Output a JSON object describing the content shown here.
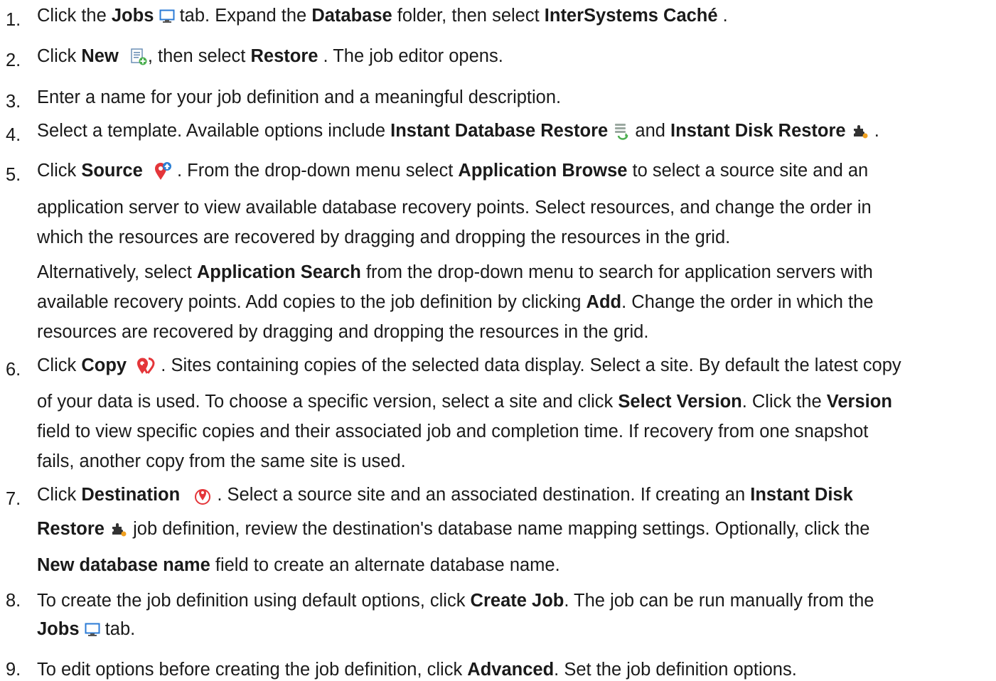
{
  "steps": [
    {
      "num": "1.",
      "t1": "Click the ",
      "b1": "Jobs",
      "t2": " tab. Expand the ",
      "b2": "Database",
      "t3": " folder, then select ",
      "b3": "InterSystems Caché",
      "t4": " ."
    },
    {
      "num": "2.",
      "t1": "Click ",
      "b1": "New",
      "t2": ", then select ",
      "b2": "Restore",
      "t3": " . The job editor opens."
    },
    {
      "num": "3.",
      "t1": "Enter a name for your job definition and a meaningful description."
    },
    {
      "num": "4.",
      "t1": "Select a template. Available options include ",
      "b1": "Instant Database Restore",
      "t2": " and ",
      "b2": "Instant Disk Restore",
      "t3": " ."
    },
    {
      "num": "5.",
      "l1": {
        "t1": "Click ",
        "b1": "Source",
        "t2": " . From the drop-down menu select ",
        "b2": "Application Browse",
        "t3": " to select a source site and an"
      },
      "l2": "application server to view available database recovery points. Select resources, and change the order in",
      "l3": "which the resources are recovered by dragging and dropping the resources in the grid.",
      "l4": {
        "t1": "Alternatively, select ",
        "b1": "Application Search",
        "t2": " from the drop-down menu to search for application servers with"
      },
      "l5": {
        "t1": "available recovery points. Add copies to the job definition by clicking ",
        "b1": "Add",
        "t2": ". Change the order in which the"
      },
      "l6": "resources are recovered by dragging and dropping the resources in the grid."
    },
    {
      "num": "6.",
      "l1": {
        "t1": "Click ",
        "b1": "Copy",
        "t2": " . Sites containing copies of the selected data display. Select a site. By default the latest copy"
      },
      "l2": {
        "t1": "of your data is used. To choose a specific version, select a site and click ",
        "b1": "Select Version",
        "t2": ". Click the ",
        "b2": "Version"
      },
      "l3": "field to view specific copies and their associated job and completion time. If recovery from one snapshot",
      "l4": "fails, another copy from the same site is used."
    },
    {
      "num": "7.",
      "l1": {
        "t1": "Click ",
        "b1": "Destination",
        "t2": " . Select a source site and an associated destination. If creating an ",
        "b2": "Instant Disk"
      },
      "l2": {
        "b1": "Restore",
        "t1": " job definition, review the destination's database name mapping settings. Optionally, click the"
      },
      "l3": {
        "b1": "New database name",
        "t1": " field to create an alternate database name."
      }
    },
    {
      "num": "8.",
      "l1": {
        "t1": "To create the job definition using default options, click ",
        "b1": "Create Job",
        "t2": ". The job can be run manually from the"
      },
      "l2": {
        "b1": "Jobs",
        "t1": " tab."
      }
    },
    {
      "num": "9.",
      "l1": {
        "t1": "To edit options before creating the job definition, click ",
        "b1": "Advanced",
        "t2": ". Set the job definition options."
      }
    }
  ],
  "icons": {
    "monitor": "monitor-icon",
    "new_job": "new-job-icon",
    "database_restore": "database-restore-icon",
    "puzzle_disk": "disk-restore-icon",
    "source": "source-pin-icon",
    "copy": "copy-pin-icon",
    "destination": "destination-pin-icon"
  },
  "colors": {
    "text": "#1a1a1a",
    "pin_red": "#e4363a",
    "pin_blue": "#2a7fd4",
    "green": "#4caf50",
    "orange": "#f0a020",
    "monitor_blue": "#2b7bd6"
  }
}
